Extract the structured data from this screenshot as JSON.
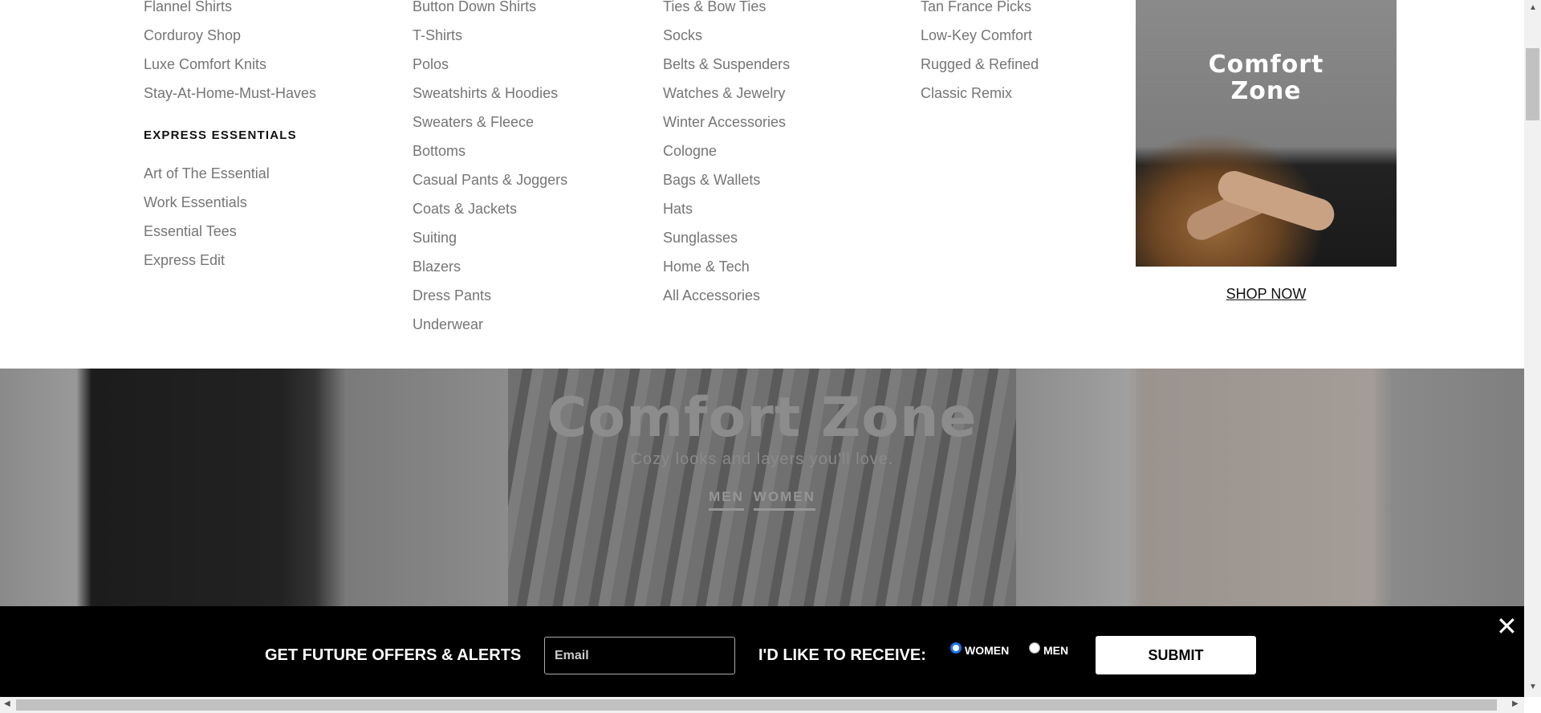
{
  "menu": {
    "col1": {
      "items_top": [
        "Flannel Shirts",
        "Corduroy Shop",
        "Luxe Comfort Knits",
        "Stay-At-Home-Must-Haves"
      ],
      "heading": "EXPRESS ESSENTIALS",
      "items_bottom": [
        "Art of The Essential",
        "Work Essentials",
        "Essential Tees",
        "Express Edit"
      ]
    },
    "col2": [
      "Button Down Shirts",
      "T-Shirts",
      "Polos",
      "Sweatshirts & Hoodies",
      "Sweaters & Fleece",
      "Bottoms",
      "Casual Pants & Joggers",
      "Coats & Jackets",
      "Suiting",
      "Blazers",
      "Dress Pants",
      "Underwear"
    ],
    "col3": [
      "Ties & Bow Ties",
      "Socks",
      "Belts & Suspenders",
      "Watches & Jewelry",
      "Winter Accessories",
      "Cologne",
      "Bags & Wallets",
      "Hats",
      "Sunglasses",
      "Home & Tech",
      "All Accessories"
    ],
    "col4": [
      "Tan France Picks",
      "Low-Key Comfort",
      "Rugged & Refined",
      "Classic Remix"
    ]
  },
  "promo": {
    "title_line1": "Comfort",
    "title_line2": "Zone",
    "cta": "SHOP NOW"
  },
  "banner": {
    "title": "Comfort Zone",
    "subtitle": "Cozy looks and layers you'll love.",
    "links": [
      "MEN",
      "WOMEN"
    ]
  },
  "signup": {
    "label": "GET FUTURE OFFERS & ALERTS",
    "email_placeholder": "Email",
    "receive_label": "I'D LIKE TO RECEIVE:",
    "options": [
      "WOMEN",
      "MEN"
    ],
    "selected": "WOMEN",
    "submit": "SUBMIT",
    "close": "✕"
  }
}
